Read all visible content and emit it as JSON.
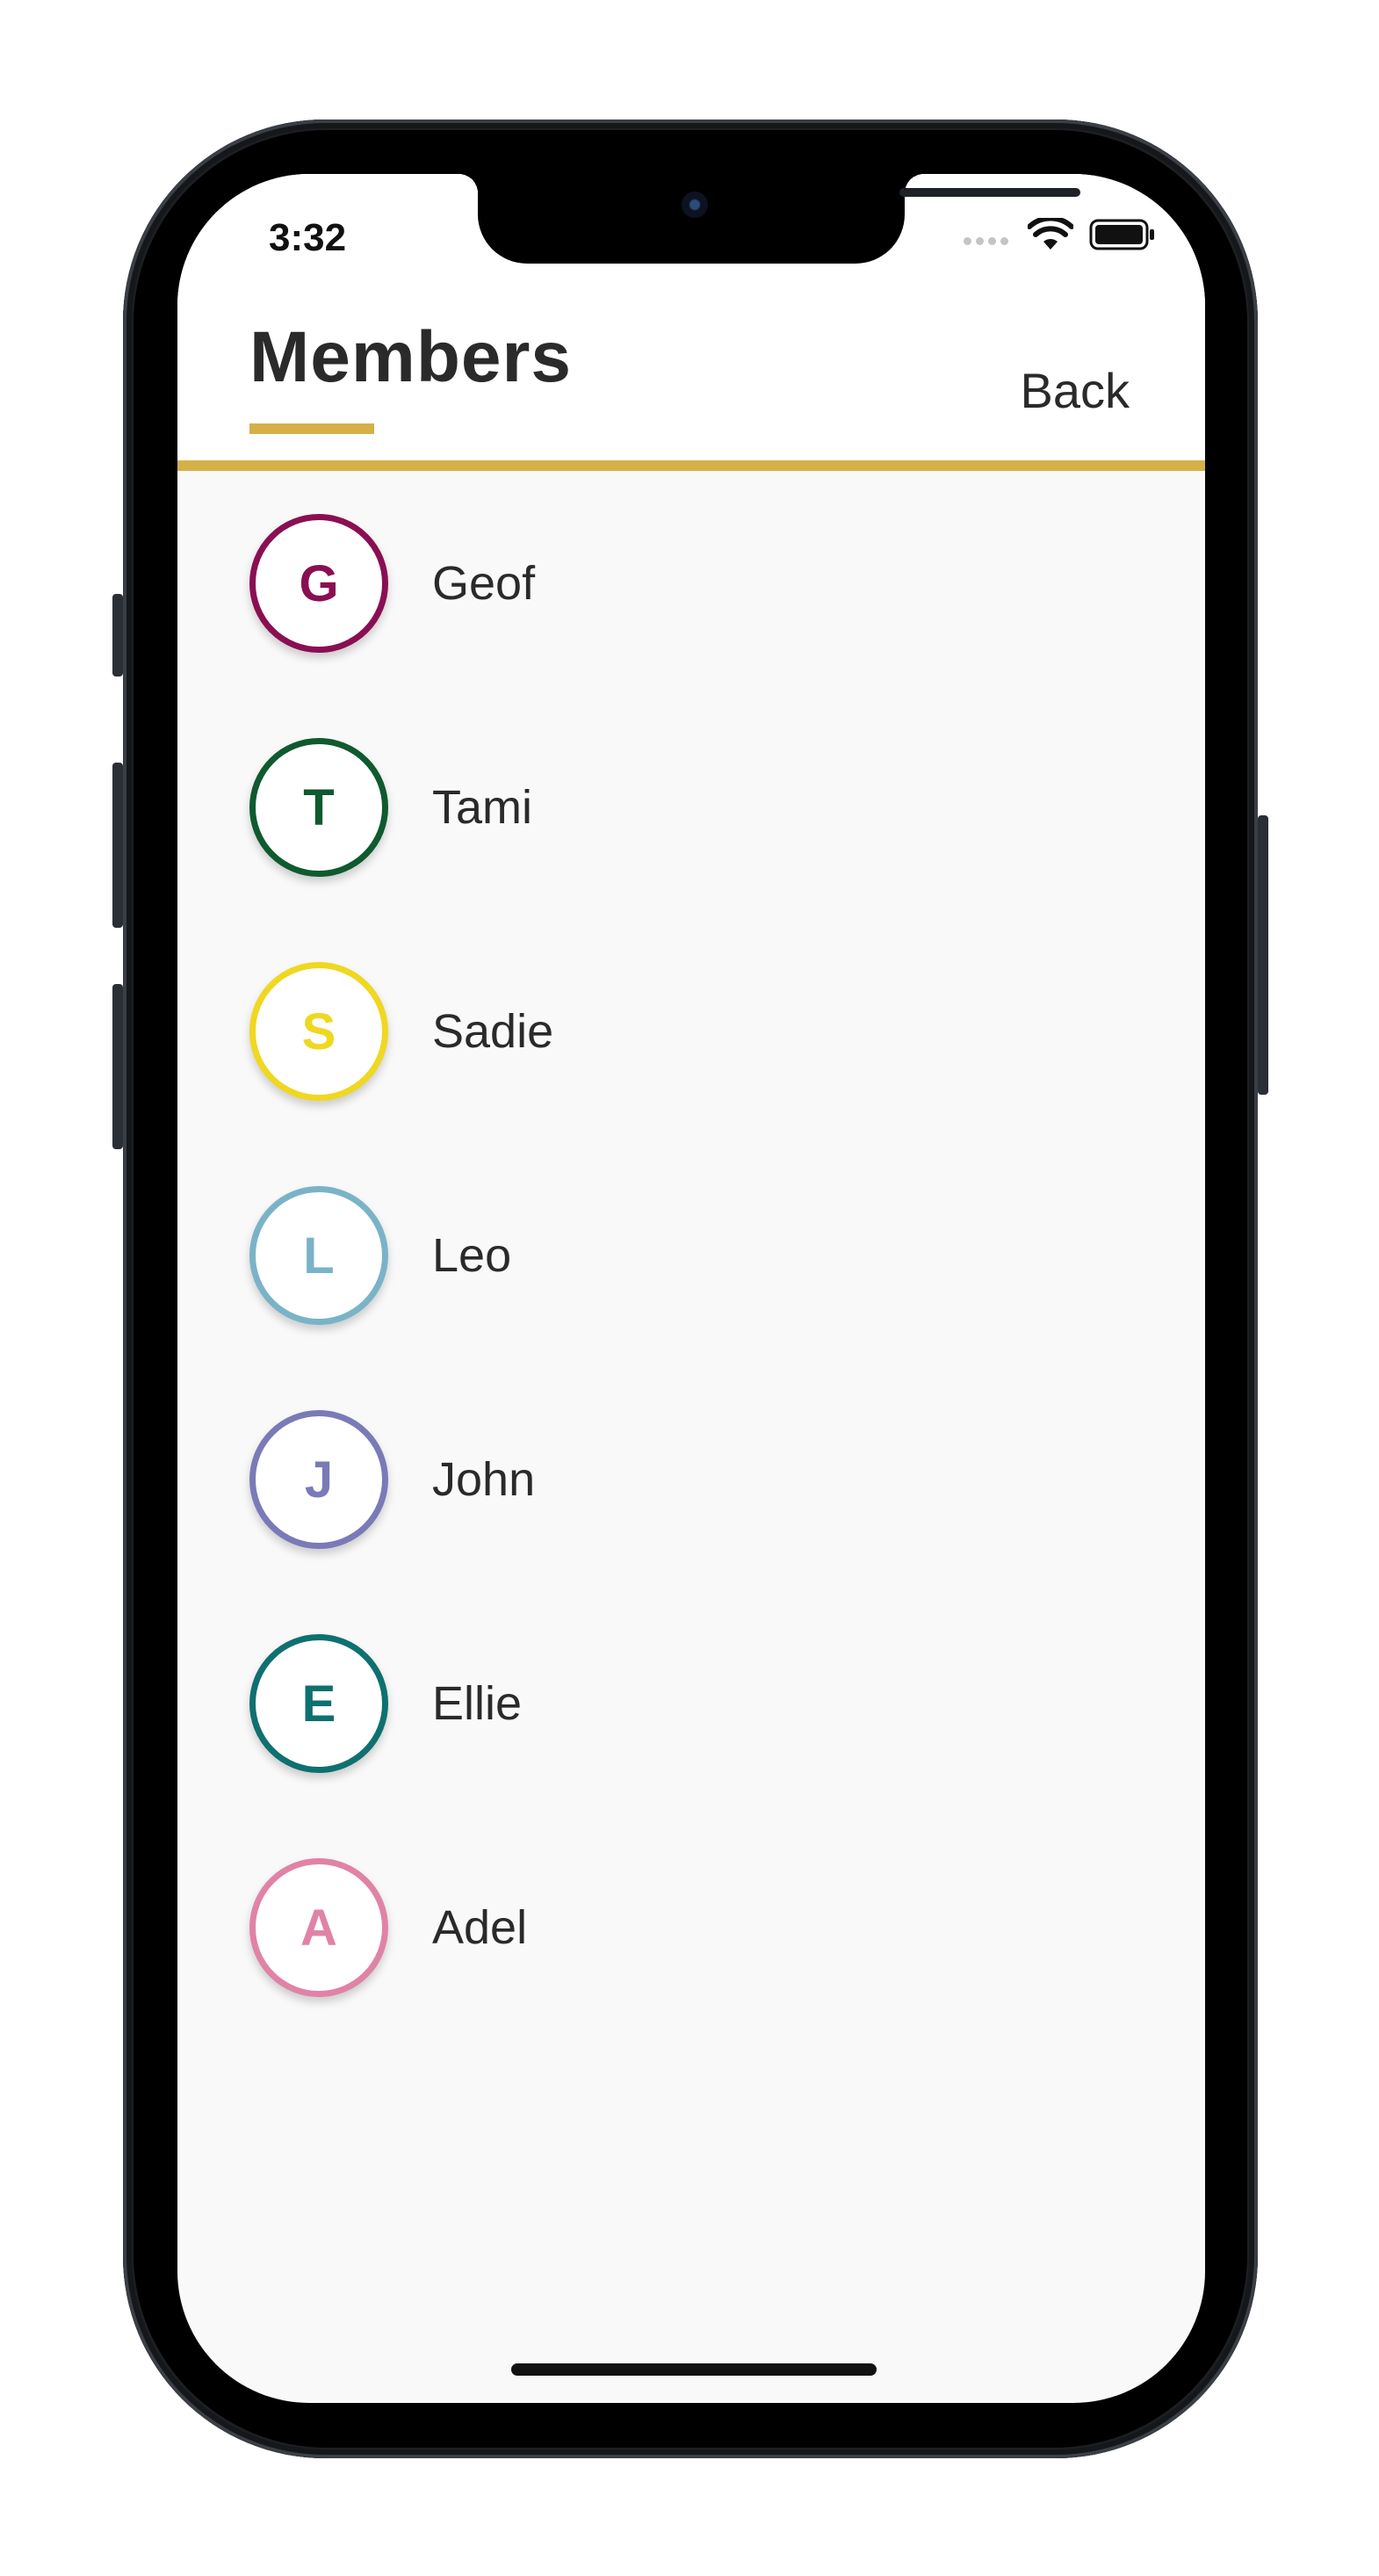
{
  "status_bar": {
    "time": "3:32"
  },
  "header": {
    "title": "Members",
    "back_label": "Back",
    "accent_color": "#d4b047"
  },
  "members": [
    {
      "initial": "G",
      "name": "Geof",
      "color": "#8a0f52"
    },
    {
      "initial": "T",
      "name": "Tami",
      "color": "#0f5a2e"
    },
    {
      "initial": "S",
      "name": "Sadie",
      "color": "#f0d720"
    },
    {
      "initial": "L",
      "name": "Leo",
      "color": "#7ab3c8"
    },
    {
      "initial": "J",
      "name": "John",
      "color": "#7a7ab8"
    },
    {
      "initial": "E",
      "name": "Ellie",
      "color": "#0f7070"
    },
    {
      "initial": "A",
      "name": "Adel",
      "color": "#e083a6"
    }
  ]
}
